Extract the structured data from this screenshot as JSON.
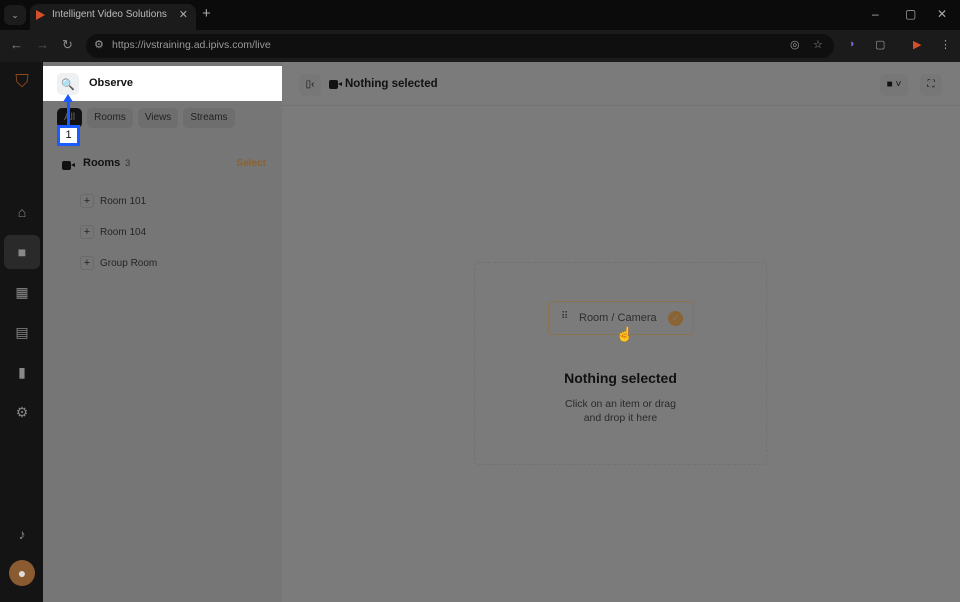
{
  "browser": {
    "tab_title": "Intelligent Video Solutions",
    "url": "https://ivstraining.ad.ipivs.com/live"
  },
  "panel": {
    "title": "Observe",
    "filters": [
      "All",
      "Rooms",
      "Views",
      "Streams"
    ],
    "section": {
      "title": "Rooms",
      "count": "3",
      "action": "Select"
    },
    "rooms": [
      "Room 101",
      "Room 104",
      "Group Room"
    ]
  },
  "marker": {
    "label": "1"
  },
  "main": {
    "title": "Nothing selected",
    "card_label": "Room / Camera",
    "empty_title": "Nothing selected",
    "empty_line1": "Click on an item or drag",
    "empty_line2": "and drop it here"
  },
  "colors": {
    "accent": "#e8a04a",
    "marker": "#1a5cff"
  }
}
